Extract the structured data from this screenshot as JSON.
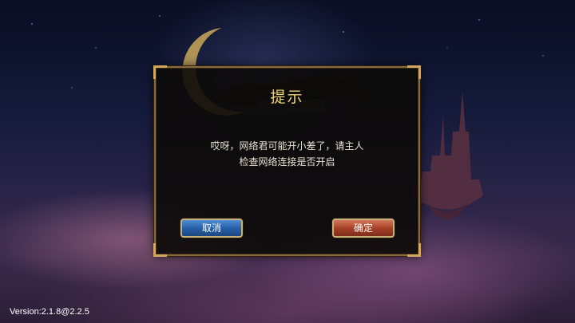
{
  "dialog": {
    "title": "提示",
    "message_line1": "哎呀，网络君可能开小差了，请主人",
    "message_line2": "检查网络连接是否开启",
    "cancel_label": "取消",
    "confirm_label": "确定"
  },
  "footer": {
    "version": "Version:2.1.8@2.2.5"
  },
  "colors": {
    "title_gold": "#f0d27a",
    "frame_gold": "#8a6a3c",
    "cancel_blue": "#2860a8",
    "confirm_red": "#a8422a"
  }
}
